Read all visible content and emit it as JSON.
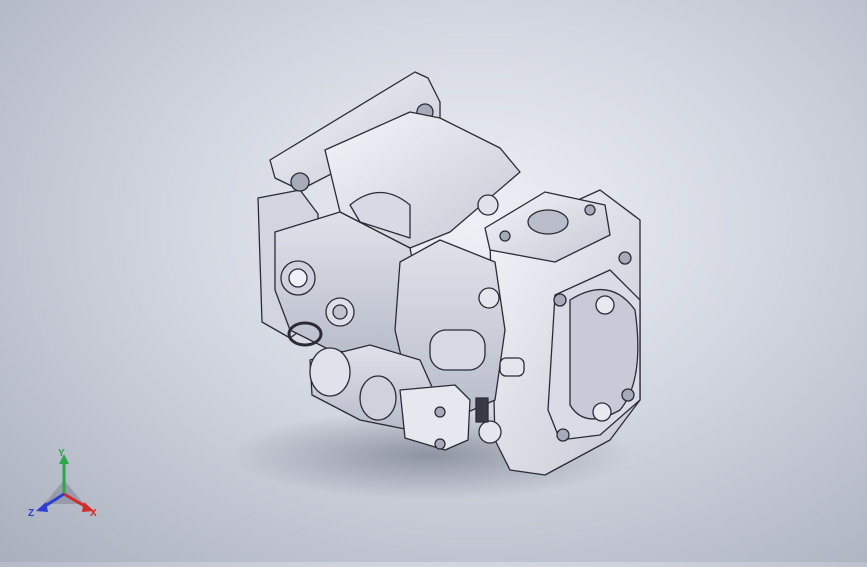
{
  "viewport": {
    "background_top": "#eef0f6",
    "background_bottom": "#a9afbd",
    "model_color": "#e6e8ef",
    "model_shade": "#c9ccd8",
    "edge_color": "#2b2b36"
  },
  "triad": {
    "y_label": "Y",
    "x_label": "X",
    "z_label": "Z",
    "y_color": "#2aa84a",
    "x_color": "#d12b2b",
    "z_color": "#2b3fd1"
  }
}
